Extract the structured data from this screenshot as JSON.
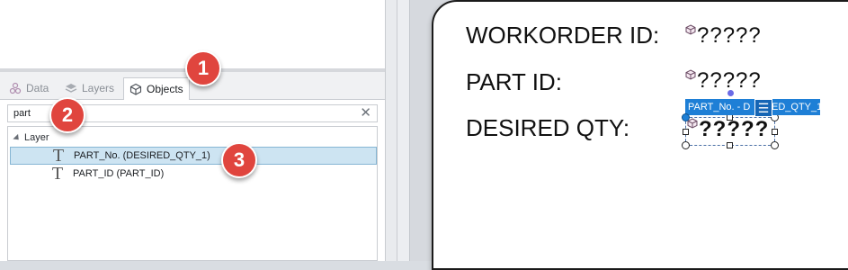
{
  "panel": {
    "tabs": [
      {
        "label": "Data",
        "icon": "data-icon"
      },
      {
        "label": "Layers",
        "icon": "layers-icon"
      },
      {
        "label": "Objects",
        "icon": "objects-icon",
        "active": true
      }
    ],
    "search": {
      "value": "part"
    },
    "tree": {
      "layer_label": "Layer",
      "items": [
        {
          "label": "PART_No. (DESIRED_QTY_1)",
          "selected": true
        },
        {
          "label": "PART_ID (PART_ID)",
          "selected": false
        }
      ]
    }
  },
  "badges": [
    "1",
    "2",
    "3"
  ],
  "label_design": {
    "fields": [
      {
        "label": "WORKORDER ID:",
        "value": "?????"
      },
      {
        "label": "PART ID:",
        "value": "?????"
      },
      {
        "label": "DESIRED QTY:",
        "value": "?????"
      }
    ],
    "selected_object_tooltip": "PART_No. - DESIRED_QTY_1",
    "tooltip_visible_left": "PART_No. - D",
    "tooltip_visible_right": "ED_QTY_1"
  },
  "colors": {
    "selection_blue": "#1e7fd6",
    "badge_red": "#e0453e",
    "selected_row": "#cde4f2"
  }
}
